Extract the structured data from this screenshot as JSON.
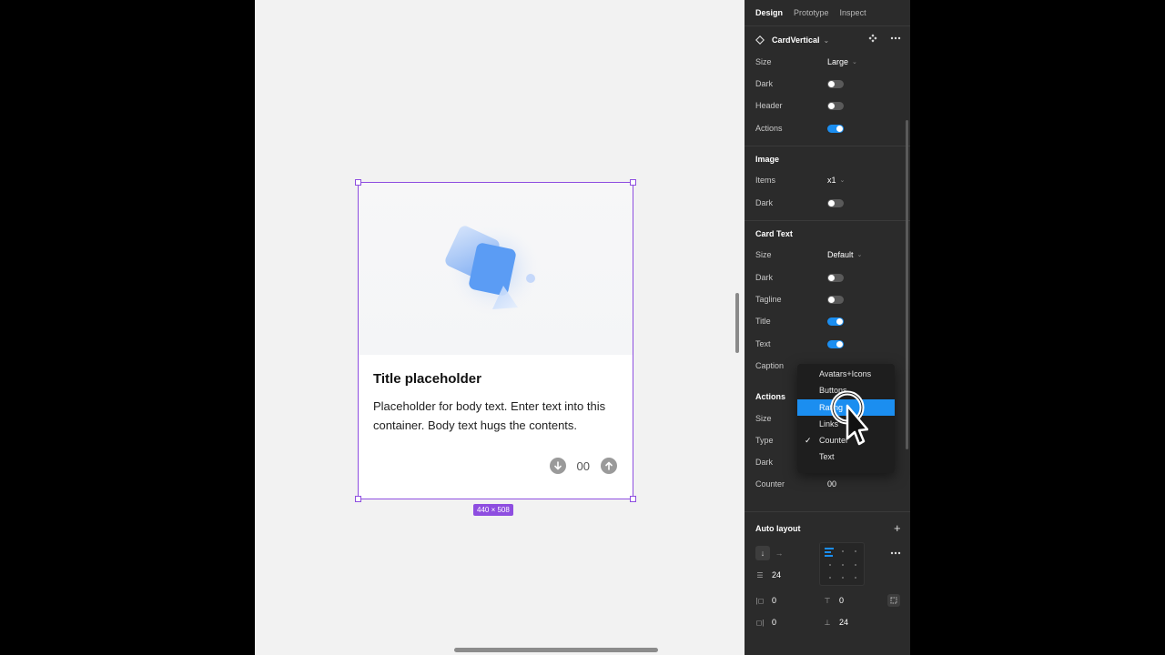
{
  "panel": {
    "tabs": [
      {
        "label": "Design",
        "active": true
      },
      {
        "label": "Prototype",
        "active": false
      },
      {
        "label": "Inspect",
        "active": false
      }
    ],
    "component": {
      "name": "CardVertical"
    },
    "properties": {
      "size": {
        "label": "Size",
        "value": "Large"
      },
      "dark": {
        "label": "Dark",
        "on": false
      },
      "header": {
        "label": "Header",
        "on": false
      },
      "actions": {
        "label": "Actions",
        "on": true
      }
    },
    "image_section": {
      "title": "Image",
      "items": {
        "label": "Items",
        "value": "x1"
      },
      "dark": {
        "label": "Dark",
        "on": false
      }
    },
    "card_text_section": {
      "title": "Card Text",
      "size": {
        "label": "Size",
        "value": "Default"
      },
      "dark": {
        "label": "Dark",
        "on": false
      },
      "tagline": {
        "label": "Tagline",
        "on": false
      },
      "title_toggle": {
        "label": "Title",
        "on": true
      },
      "text": {
        "label": "Text",
        "on": true
      },
      "caption": {
        "label": "Caption"
      }
    },
    "actions_section": {
      "title": "Actions",
      "size": {
        "label": "Size"
      },
      "type": {
        "label": "Type"
      },
      "dark": {
        "label": "Dark"
      },
      "counter": {
        "label": "Counter",
        "value": "00"
      }
    },
    "dropdown": {
      "options": [
        {
          "label": "Avatars+Icons",
          "highlighted": false,
          "checked": false
        },
        {
          "label": "Buttons",
          "highlighted": false,
          "checked": false
        },
        {
          "label": "Rating",
          "highlighted": true,
          "checked": false
        },
        {
          "label": "Links",
          "highlighted": false,
          "checked": false
        },
        {
          "label": "Counter",
          "highlighted": false,
          "checked": true
        },
        {
          "label": "Text",
          "highlighted": false,
          "checked": false
        }
      ]
    },
    "auto_layout": {
      "title": "Auto layout",
      "spacing": "24",
      "padding_left": "0",
      "padding_top": "0",
      "padding_right": "0",
      "padding_bottom": "24"
    }
  },
  "card": {
    "title": "Title placeholder",
    "body": "Placeholder for body text. Enter text into this container. Body text hugs the contents.",
    "counter": "00"
  },
  "selection": {
    "size_label": "440 × 508"
  },
  "colors": {
    "accent": "#1b8ef0",
    "selection": "#8e4ee0",
    "panel_bg": "#2b2b2b"
  }
}
